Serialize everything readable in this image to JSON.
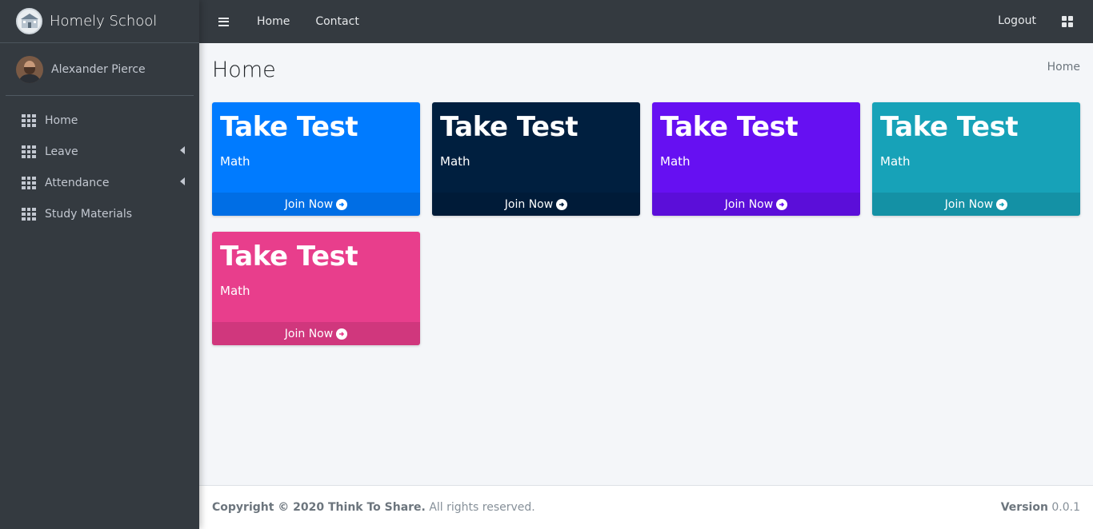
{
  "brand": {
    "name": "Homely School"
  },
  "user": {
    "name": "Alexander Pierce"
  },
  "sidebar": {
    "items": [
      {
        "label": "Home",
        "has_caret": false
      },
      {
        "label": "Leave",
        "has_caret": true
      },
      {
        "label": "Attendance",
        "has_caret": true
      },
      {
        "label": "Study Materials",
        "has_caret": false
      }
    ]
  },
  "topbar": {
    "home": "Home",
    "contact": "Contact",
    "logout": "Logout"
  },
  "page": {
    "title": "Home",
    "breadcrumb": "Home"
  },
  "cards": [
    {
      "title": "Take Test",
      "subject": "Math",
      "action": "Join Now",
      "color": "#007bff"
    },
    {
      "title": "Take Test",
      "subject": "Math",
      "action": "Join Now",
      "color": "#001f3f"
    },
    {
      "title": "Take Test",
      "subject": "Math",
      "action": "Join Now",
      "color": "#6610f2"
    },
    {
      "title": "Take Test",
      "subject": "Math",
      "action": "Join Now",
      "color": "#17a2b8"
    },
    {
      "title": "Take Test",
      "subject": "Math",
      "action": "Join Now",
      "color": "#e83e8c"
    }
  ],
  "footer": {
    "copyright": "Copyright © 2020 Think To Share.",
    "rights": "All rights reserved.",
    "version_label": "Version",
    "version": "0.0.1"
  }
}
